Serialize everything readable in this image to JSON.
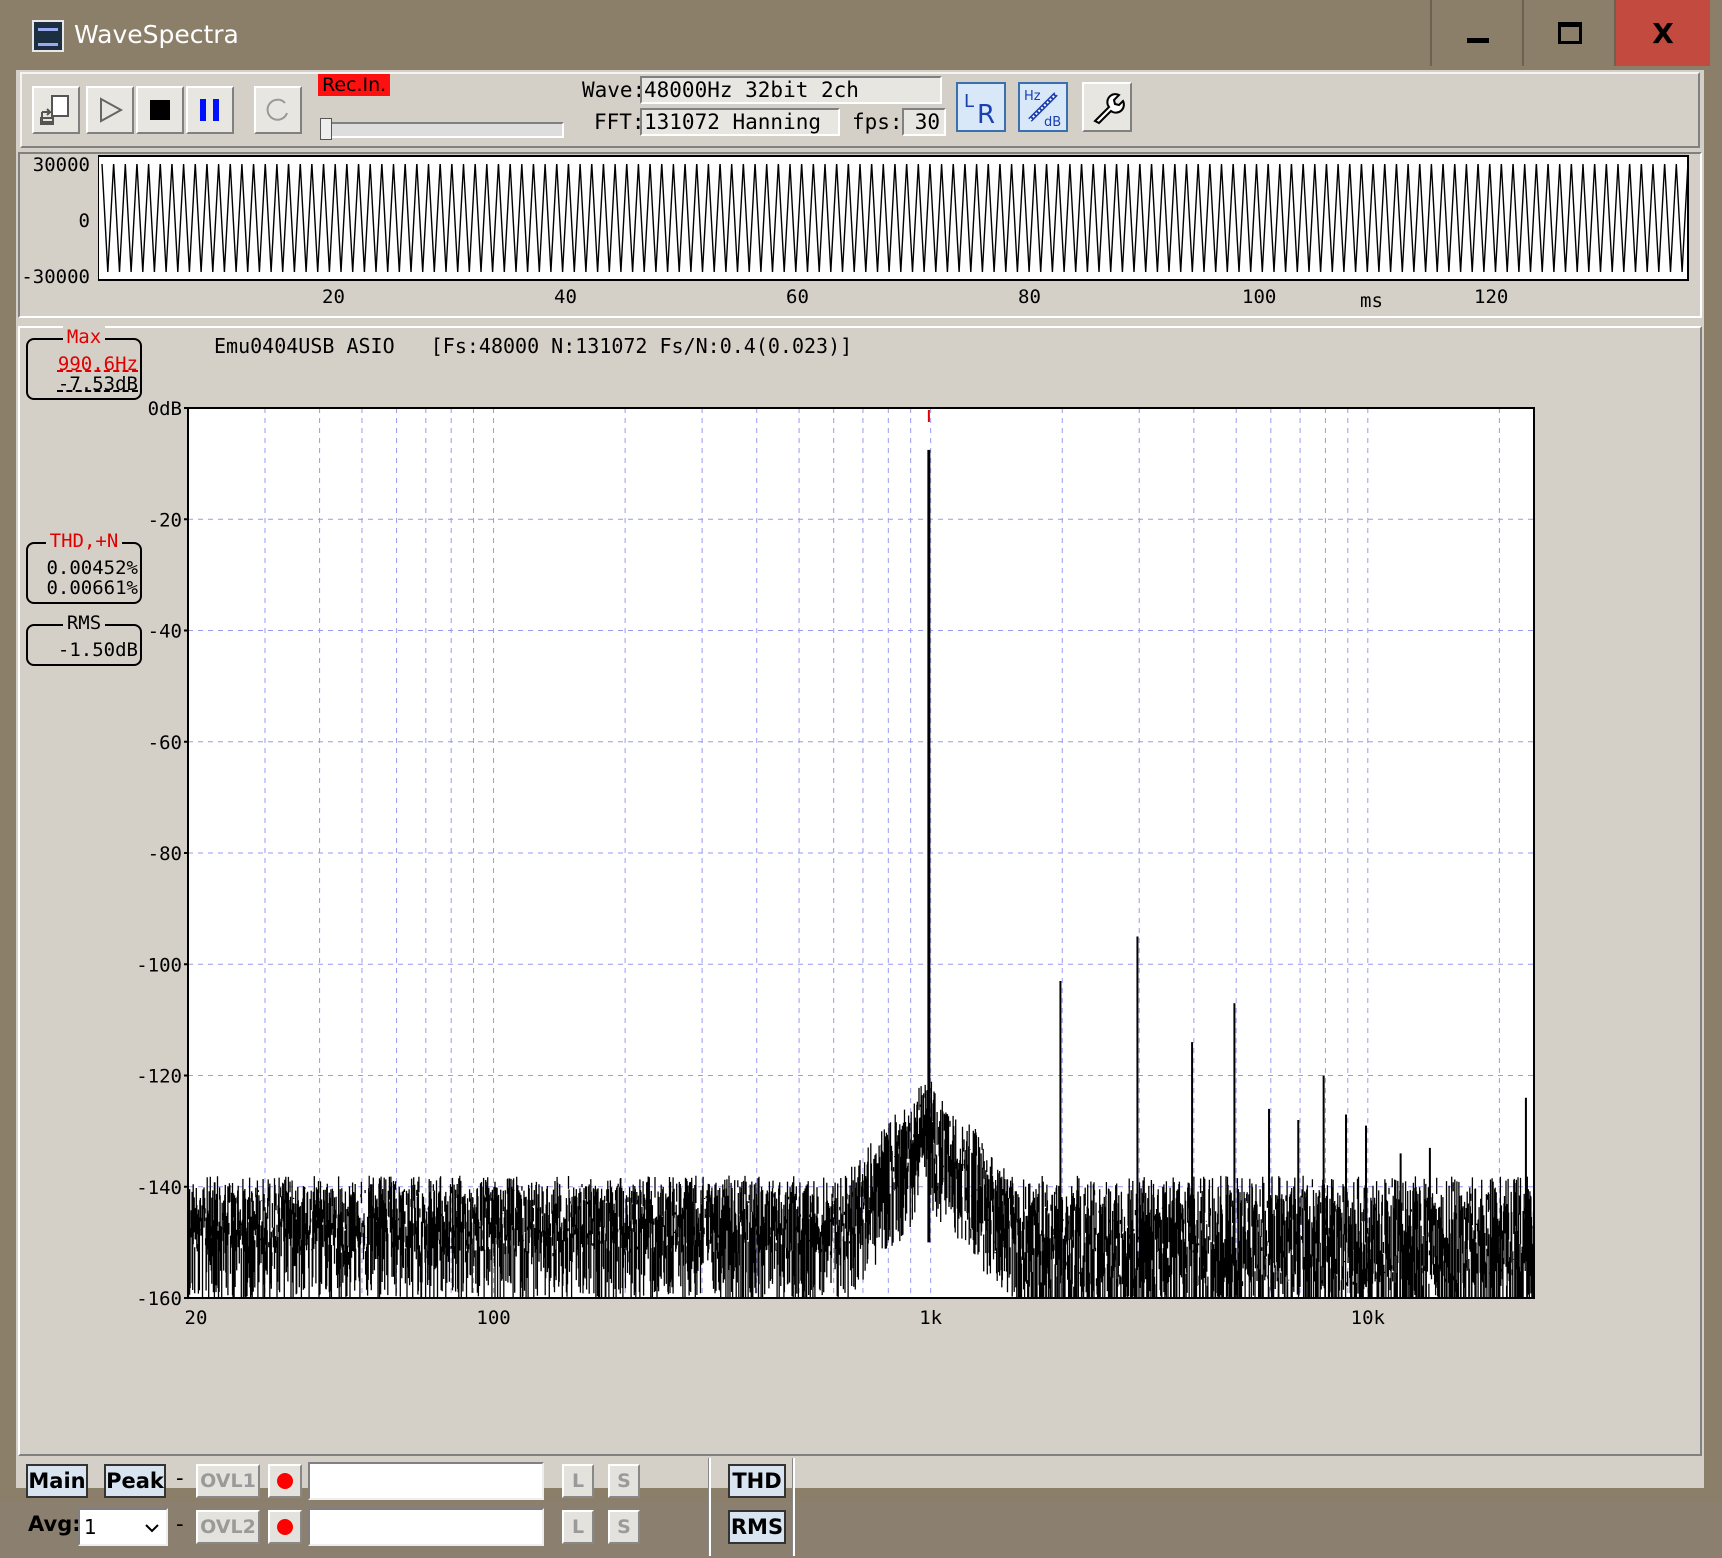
{
  "window": {
    "title": "WaveSpectra",
    "close_glyph": "X"
  },
  "toolbar": {
    "rec_label": "Rec.In.",
    "wave_label": "Wave:",
    "wave_value": "48000Hz 32bit 2ch",
    "fft_label": "FFT:",
    "fft_value": "131072 Hanning",
    "fps_label": "fps:",
    "fps_value": "30",
    "icons": [
      "export-icon",
      "play-icon",
      "stop-icon",
      "pause-icon",
      "repeat-icon",
      "lr-icon",
      "hz-db-icon",
      "settings-wrench-icon"
    ]
  },
  "waveform": {
    "yticks": [
      "30000",
      "0",
      "-30000"
    ],
    "xticks": [
      "20",
      "40",
      "60",
      "80",
      "100",
      "120"
    ],
    "xunit": "ms"
  },
  "spectrum": {
    "header": "Emu0404USB ASIO   [Fs:48000 N:131072 Fs/N:0.4(0.023)]",
    "max_caption": "Max",
    "max_freq": "990.6Hz",
    "max_db": "-7.53dB",
    "thd_caption": "THD,+N",
    "thd_value": "0.00452%",
    "thdn_value": "0.00661%",
    "rms_caption": "RMS",
    "rms_value": "-1.50dB"
  },
  "chart_data": {
    "type": "line",
    "title": "",
    "xlabel": "",
    "ylabel": "",
    "x_scale": "log",
    "xlim": [
      20,
      24000
    ],
    "ylim": [
      -160,
      0
    ],
    "ytick_labels": [
      "0dB",
      "-20",
      "-40",
      "-60",
      "-80",
      "-100",
      "-120",
      "-140",
      "-160"
    ],
    "xtick_labels": [
      "20",
      "100",
      "1k",
      "10k"
    ],
    "grid": true,
    "noise_floor_db": -140,
    "peaks": [
      {
        "x": 990.6,
        "y": -7.53
      },
      {
        "x": 1981,
        "y": -103
      },
      {
        "x": 2972,
        "y": -95
      },
      {
        "x": 3963,
        "y": -114
      },
      {
        "x": 4953,
        "y": -107
      },
      {
        "x": 5944,
        "y": -126
      },
      {
        "x": 6934,
        "y": -128
      },
      {
        "x": 7925,
        "y": -120
      },
      {
        "x": 8916,
        "y": -127
      },
      {
        "x": 9906,
        "y": -129
      },
      {
        "x": 11888,
        "y": -134
      },
      {
        "x": 13869,
        "y": -133
      },
      {
        "x": 23000,
        "y": -124
      }
    ]
  },
  "bottom": {
    "main_label": "Main",
    "peak_label": "Peak",
    "dash": "-",
    "ovl1_label": "OVL1",
    "ovl2_label": "OVL2",
    "l_label": "L",
    "s_label": "S",
    "avg_label": "Avg:",
    "avg_value": "1",
    "thd_label": "THD",
    "rms_label": "RMS"
  }
}
